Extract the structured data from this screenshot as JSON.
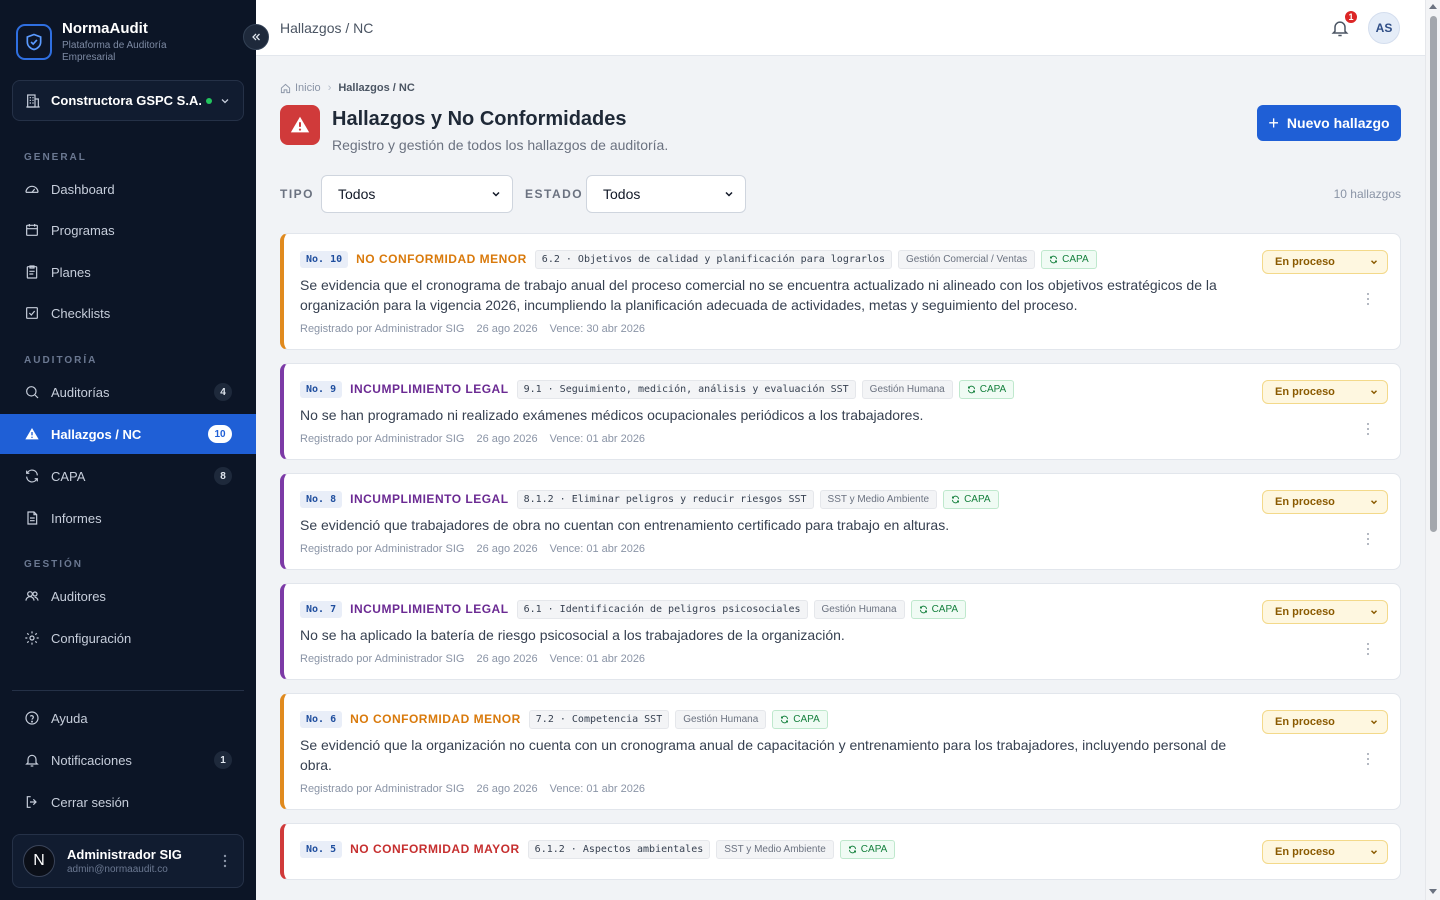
{
  "brand": {
    "name": "NormaAudit",
    "subtitle": "Plataforma de Auditoría Empresarial"
  },
  "organization": {
    "name": "Constructora GSPC S.A...",
    "status_color": "#22c55e"
  },
  "nav": {
    "sections": {
      "general": "GENERAL",
      "auditoria": "AUDITORÍA",
      "gestion": "GESTIÓN"
    },
    "items": [
      {
        "label": "Dashboard",
        "icon": "dashboard-icon"
      },
      {
        "label": "Programas",
        "icon": "calendar-icon"
      },
      {
        "label": "Planes",
        "icon": "clipboard-icon"
      },
      {
        "label": "Checklists",
        "icon": "checkbox-icon"
      },
      {
        "label": "Auditorías",
        "icon": "search-icon",
        "badge": "4"
      },
      {
        "label": "Hallazgos / NC",
        "icon": "warning-icon",
        "badge": "10",
        "active": true
      },
      {
        "label": "CAPA",
        "icon": "refresh-icon",
        "badge": "8"
      },
      {
        "label": "Informes",
        "icon": "document-icon"
      },
      {
        "label": "Auditores",
        "icon": "users-icon"
      },
      {
        "label": "Configuración",
        "icon": "gear-icon"
      }
    ],
    "footer": [
      {
        "label": "Ayuda",
        "icon": "help-icon"
      },
      {
        "label": "Notificaciones",
        "icon": "bell-icon",
        "badge": "1"
      },
      {
        "label": "Cerrar sesión",
        "icon": "logout-icon"
      }
    ]
  },
  "user": {
    "initial": "N",
    "name": "Administrador SIG",
    "email": "admin@normaaudit.co",
    "avatar_initials": "AS"
  },
  "topbar": {
    "title": "Hallazgos / NC",
    "notifications": "1"
  },
  "breadcrumb": {
    "home": "Inicio",
    "current": "Hallazgos / NC"
  },
  "page": {
    "title": "Hallazgos y No Conformidades",
    "subtitle": "Registro y gestión de todos los hallazgos de auditoría.",
    "new_button": "Nuevo hallazgo",
    "accent": "#1f5fd6"
  },
  "filters": {
    "type_label": "TIPO",
    "type_value": "Todos",
    "status_label": "ESTADO",
    "status_value": "Todos",
    "count": "10 hallazgos"
  },
  "findings": [
    {
      "number": "No. 10",
      "kind": "minor",
      "type": "NO CONFORMIDAD MENOR",
      "clause": "6.2 · Objetivos de calidad y planificación para lograrlos",
      "area": "Gestión Comercial / Ventas",
      "capa": "CAPA",
      "description": "Se evidencia que el cronograma de trabajo anual del proceso comercial no se encuentra actualizado ni alineado con los objetivos estratégicos de la organización para la vigencia 2026, incumpliendo la planificación adecuada de actividades, metas y seguimiento del proceso.",
      "registered_by": "Registrado por Administrador SIG",
      "date": "26 ago 2026",
      "due": "Vence: 30 abr 2026",
      "status": "En proceso"
    },
    {
      "number": "No. 9",
      "kind": "legal",
      "type": "INCUMPLIMIENTO LEGAL",
      "clause": "9.1 · Seguimiento, medición, análisis y evaluación SST",
      "area": "Gestión Humana",
      "capa": "CAPA",
      "description": "No se han programado ni realizado exámenes médicos ocupacionales periódicos a los trabajadores.",
      "registered_by": "Registrado por Administrador SIG",
      "date": "26 ago 2026",
      "due": "Vence: 01 abr 2026",
      "status": "En proceso"
    },
    {
      "number": "No. 8",
      "kind": "legal",
      "type": "INCUMPLIMIENTO LEGAL",
      "clause": "8.1.2 · Eliminar peligros y reducir riesgos SST",
      "area": "SST y Medio Ambiente",
      "capa": "CAPA",
      "description": "Se evidenció que trabajadores de obra no cuentan con entrenamiento certificado para trabajo en alturas.",
      "registered_by": "Registrado por Administrador SIG",
      "date": "26 ago 2026",
      "due": "Vence: 01 abr 2026",
      "status": "En proceso"
    },
    {
      "number": "No. 7",
      "kind": "legal",
      "type": "INCUMPLIMIENTO LEGAL",
      "clause": "6.1 · Identificación de peligros psicosociales",
      "area": "Gestión Humana",
      "capa": "CAPA",
      "description": "No se ha aplicado la batería de riesgo psicosocial a los trabajadores de la organización.",
      "registered_by": "Registrado por Administrador SIG",
      "date": "26 ago 2026",
      "due": "Vence: 01 abr 2026",
      "status": "En proceso"
    },
    {
      "number": "No. 6",
      "kind": "minor",
      "type": "NO CONFORMIDAD MENOR",
      "clause": "7.2 · Competencia SST",
      "area": "Gestión Humana",
      "capa": "CAPA",
      "description": "Se evidenció que la organización no cuenta con un cronograma anual de capacitación y entrenamiento para los trabajadores, incluyendo personal de obra.",
      "registered_by": "Registrado por Administrador SIG",
      "date": "26 ago 2026",
      "due": "Vence: 01 abr 2026",
      "status": "En proceso"
    },
    {
      "number": "No. 5",
      "kind": "major",
      "type": "NO CONFORMIDAD MAYOR",
      "clause": "6.1.2 · Aspectos ambientales",
      "area": "SST y Medio Ambiente",
      "capa": "CAPA",
      "description": "",
      "registered_by": "",
      "date": "",
      "due": "",
      "status": "En proceso"
    }
  ]
}
